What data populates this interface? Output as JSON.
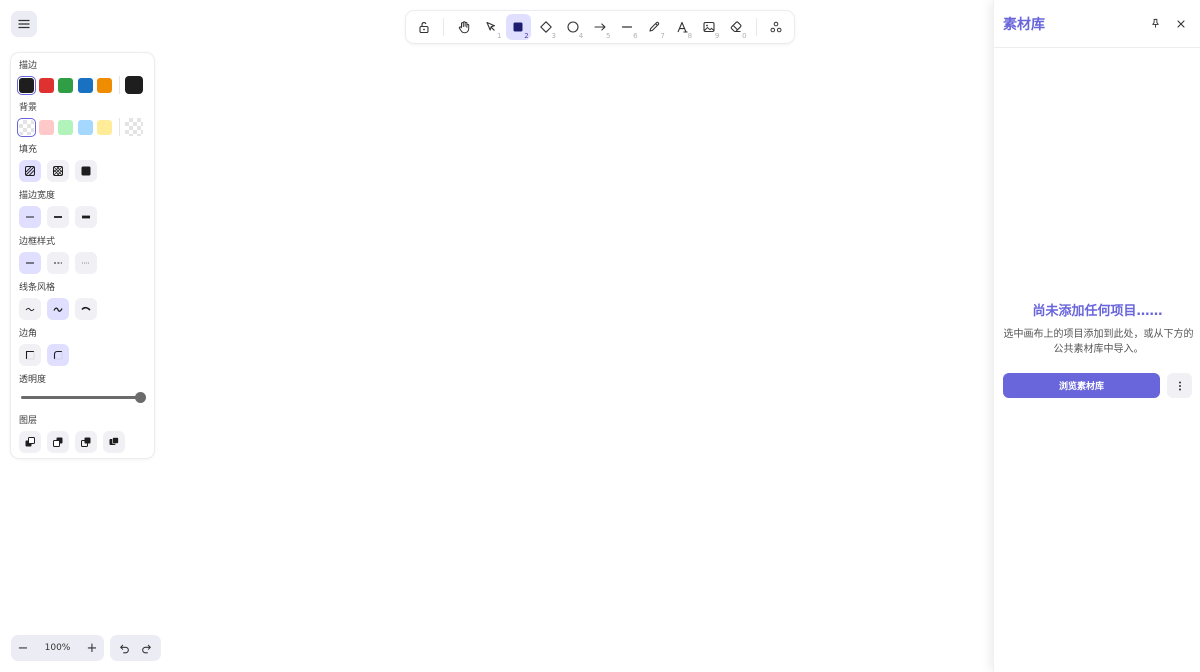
{
  "toolbar": {
    "tools": [
      {
        "name": "lock",
        "key": ""
      },
      {
        "name": "hand",
        "key": ""
      },
      {
        "name": "selection",
        "key": "1"
      },
      {
        "name": "rectangle",
        "key": "2"
      },
      {
        "name": "diamond",
        "key": "3"
      },
      {
        "name": "ellipse",
        "key": "4"
      },
      {
        "name": "arrow",
        "key": "5"
      },
      {
        "name": "line",
        "key": "6"
      },
      {
        "name": "draw",
        "key": "7"
      },
      {
        "name": "text",
        "key": "8"
      },
      {
        "name": "image",
        "key": "9"
      },
      {
        "name": "eraser",
        "key": "0"
      },
      {
        "name": "extra-tools",
        "key": ""
      }
    ],
    "active_tool": "rectangle"
  },
  "properties": {
    "stroke_label": "描边",
    "stroke_colors": [
      "#1e1e1e",
      "#e03131",
      "#2f9e44",
      "#1971c2",
      "#f08c00"
    ],
    "stroke_current": "#1e1e1e",
    "background_label": "背景",
    "background_colors": [
      "transparent",
      "#ffc9c9",
      "#b2f2bb",
      "#a5d8ff",
      "#ffec99"
    ],
    "fill_label": "填充",
    "stroke_width_label": "描边宽度",
    "stroke_style_label": "边框样式",
    "sloppiness_label": "线条风格",
    "edges_label": "边角",
    "opacity_label": "透明度",
    "opacity_value": 100,
    "layers_label": "图层"
  },
  "zoom": {
    "value": "100%",
    "minus": "−",
    "plus": "+"
  },
  "library": {
    "title": "素材库",
    "empty_title": "尚未添加任何项目……",
    "empty_desc": "选中画布上的项目添加到此处，或从下方的公共素材库中导入。",
    "browse_label": "浏览素材库"
  },
  "colors": {
    "accent": "#6965db",
    "accent_light": "#e0dfff"
  }
}
